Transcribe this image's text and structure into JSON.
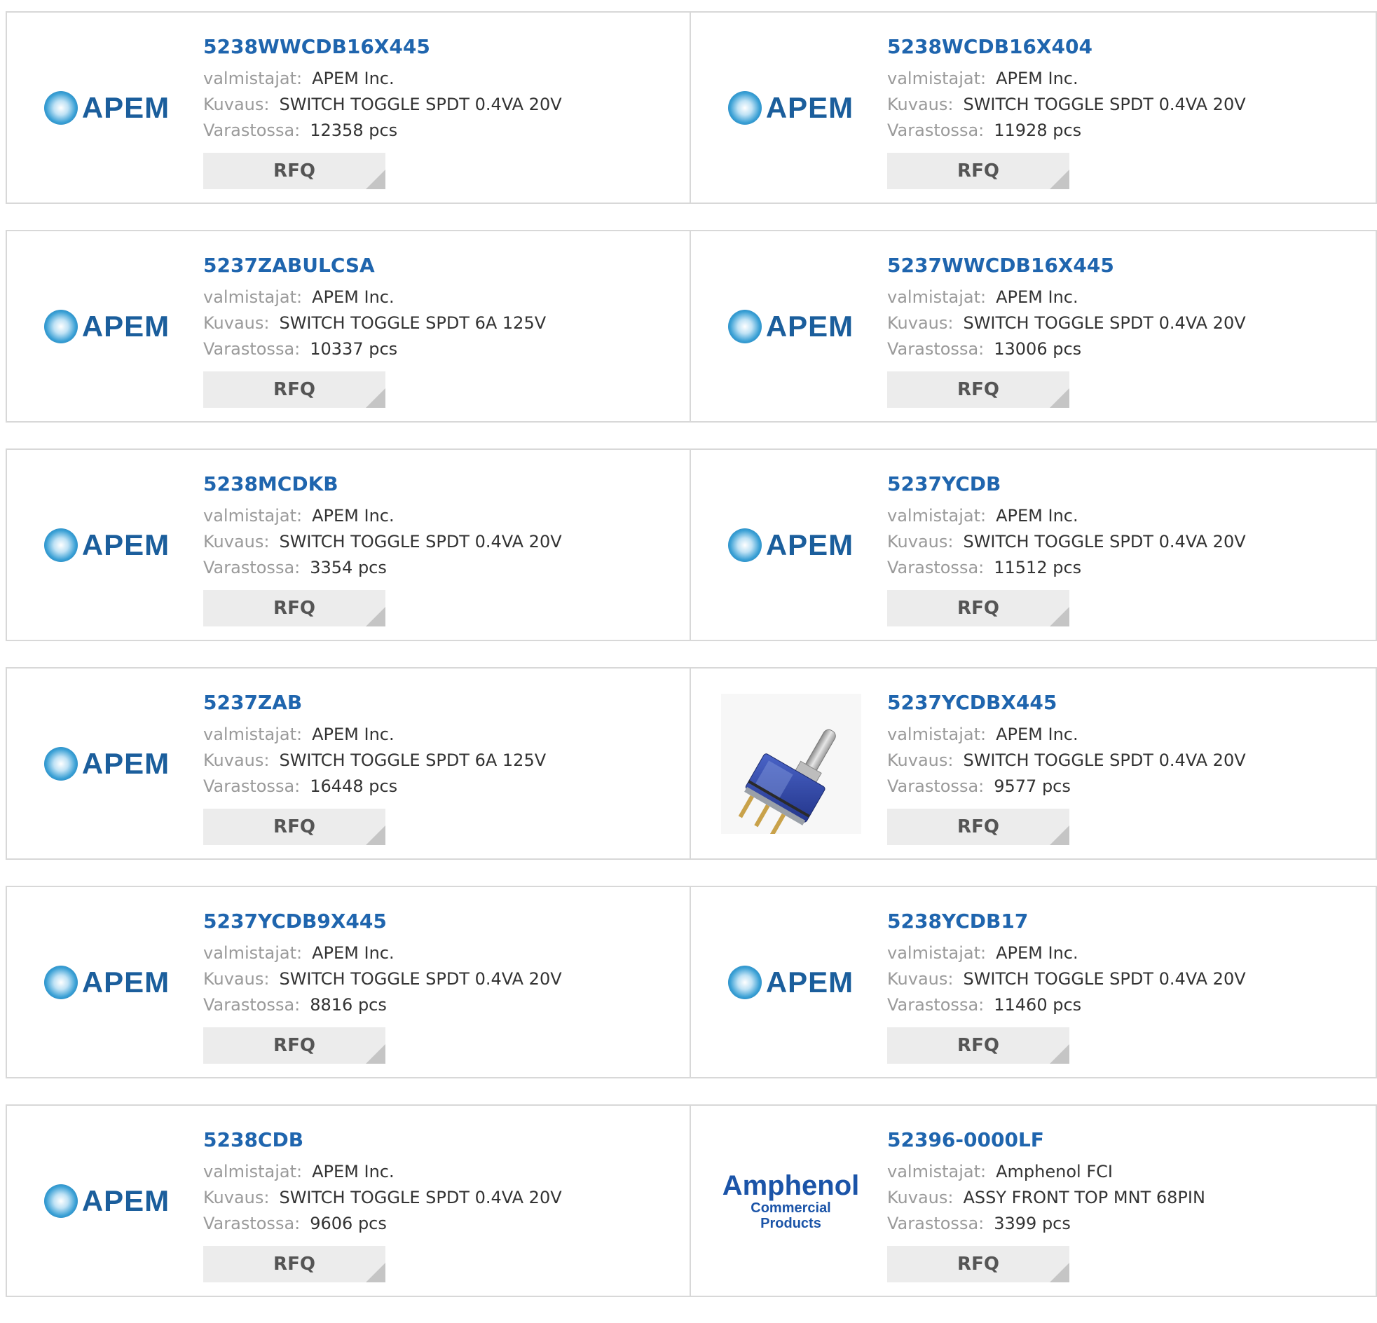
{
  "labels": {
    "manufacturer": "valmistajat:",
    "description": "Kuvaus:",
    "stock": "Varastossa:",
    "rfq": "RFQ"
  },
  "logos": {
    "apem": "APEM",
    "amphenol_main": "Amphenol",
    "amphenol_sub": "Commercial Products"
  },
  "products": [
    {
      "part": "5238WWCDB16X445",
      "manufacturer": "APEM Inc.",
      "description": "SWITCH TOGGLE SPDT 0.4VA 20V",
      "stock": "12358 pcs",
      "logo": "apem"
    },
    {
      "part": "5238WCDB16X404",
      "manufacturer": "APEM Inc.",
      "description": "SWITCH TOGGLE SPDT 0.4VA 20V",
      "stock": "11928 pcs",
      "logo": "apem"
    },
    {
      "part": "5237ZABULCSA",
      "manufacturer": "APEM Inc.",
      "description": "SWITCH TOGGLE SPDT 6A 125V",
      "stock": "10337 pcs",
      "logo": "apem"
    },
    {
      "part": "5237WWCDB16X445",
      "manufacturer": "APEM Inc.",
      "description": "SWITCH TOGGLE SPDT 0.4VA 20V",
      "stock": "13006 pcs",
      "logo": "apem"
    },
    {
      "part": "5238MCDKB",
      "manufacturer": "APEM Inc.",
      "description": "SWITCH TOGGLE SPDT 0.4VA 20V",
      "stock": "3354 pcs",
      "logo": "apem"
    },
    {
      "part": "5237YCDB",
      "manufacturer": "APEM Inc.",
      "description": "SWITCH TOGGLE SPDT 0.4VA 20V",
      "stock": "11512 pcs",
      "logo": "apem"
    },
    {
      "part": "5237ZAB",
      "manufacturer": "APEM Inc.",
      "description": "SWITCH TOGGLE SPDT 6A 125V",
      "stock": "16448 pcs",
      "logo": "apem"
    },
    {
      "part": "5237YCDBX445",
      "manufacturer": "APEM Inc.",
      "description": "SWITCH TOGGLE SPDT 0.4VA 20V",
      "stock": "9577 pcs",
      "logo": "switch-photo"
    },
    {
      "part": "5237YCDB9X445",
      "manufacturer": "APEM Inc.",
      "description": "SWITCH TOGGLE SPDT 0.4VA 20V",
      "stock": "8816 pcs",
      "logo": "apem"
    },
    {
      "part": "5238YCDB17",
      "manufacturer": "APEM Inc.",
      "description": "SWITCH TOGGLE SPDT 0.4VA 20V",
      "stock": "11460 pcs",
      "logo": "apem"
    },
    {
      "part": "5238CDB",
      "manufacturer": "APEM Inc.",
      "description": "SWITCH TOGGLE SPDT 0.4VA 20V",
      "stock": "9606 pcs",
      "logo": "apem"
    },
    {
      "part": "52396-0000LF",
      "manufacturer": "Amphenol FCI",
      "description": "ASSY FRONT TOP MNT 68PIN",
      "stock": "3399 pcs",
      "logo": "amphenol"
    }
  ]
}
